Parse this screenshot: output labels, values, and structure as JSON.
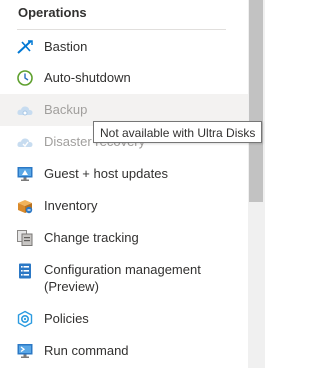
{
  "section": {
    "title": "Operations"
  },
  "menu": {
    "items": [
      {
        "label": "Bastion",
        "icon": "bastion-icon",
        "disabled": false
      },
      {
        "label": "Auto-shutdown",
        "icon": "clock-icon",
        "disabled": false
      },
      {
        "label": "Backup",
        "icon": "cloud-backup-icon",
        "disabled": true
      },
      {
        "label": "Disaster recovery",
        "icon": "cloud-recovery-icon",
        "disabled": true
      },
      {
        "label": "Guest + host updates",
        "icon": "monitor-update-icon",
        "disabled": false
      },
      {
        "label": "Inventory",
        "icon": "box-inventory-icon",
        "disabled": false
      },
      {
        "label": "Change tracking",
        "icon": "change-tracking-icon",
        "disabled": false
      },
      {
        "label": "Configuration management",
        "label_line2": "(Preview)",
        "icon": "config-list-icon",
        "disabled": false
      },
      {
        "label": "Policies",
        "icon": "policy-gear-icon",
        "disabled": false
      },
      {
        "label": "Run command",
        "icon": "terminal-run-icon",
        "disabled": false
      }
    ]
  },
  "tooltip": {
    "text": "Not available with Ultra Disks"
  },
  "colors": {
    "text": "#323130",
    "disabled_text": "#a19f9d",
    "accent_blue": "#0078d4",
    "hover_bg": "#f3f2f1"
  }
}
